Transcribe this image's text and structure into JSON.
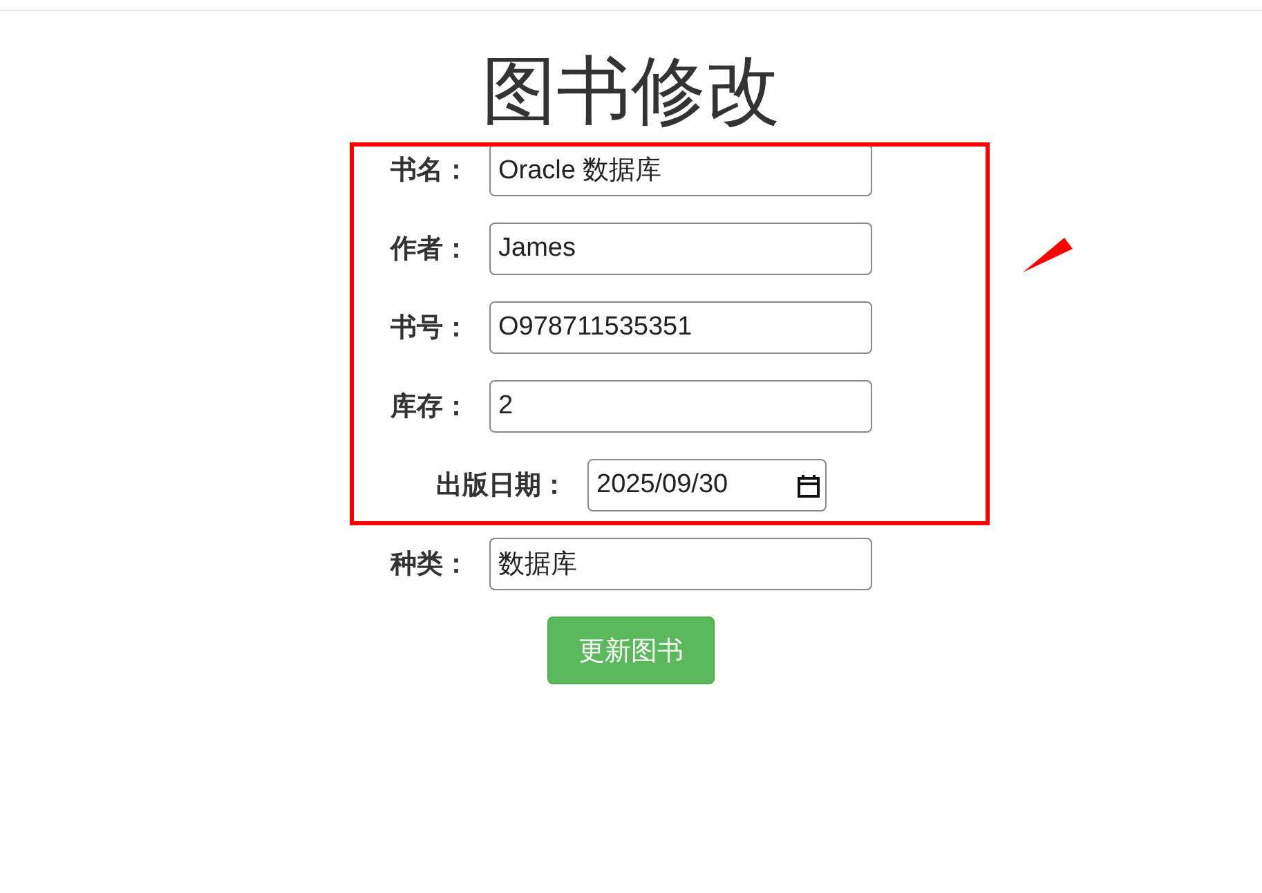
{
  "title": "图书修改",
  "fields": [
    {
      "label": "书名：",
      "value": "Oracle 数据库",
      "kind": "text"
    },
    {
      "label": "作者：",
      "value": "James",
      "kind": "text"
    },
    {
      "label": "书号：",
      "value": "O978711535351",
      "kind": "text"
    },
    {
      "label": "库存：",
      "value": "2",
      "kind": "text"
    },
    {
      "label": "出版日期：",
      "value": "2025/09/30",
      "kind": "date"
    },
    {
      "label": "种类：",
      "value": "数据库",
      "kind": "text"
    }
  ],
  "submit_button": "更新图书"
}
